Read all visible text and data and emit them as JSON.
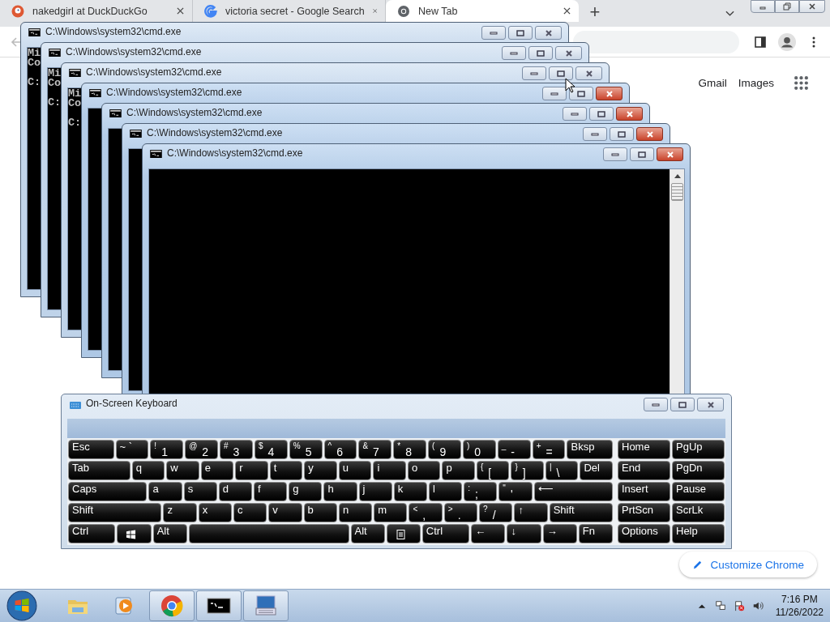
{
  "browser": {
    "tabs": [
      {
        "title": "nakedgirl at DuckDuckGo",
        "selected": false
      },
      {
        "title": "victoria secret - Google Search",
        "selected": false
      },
      {
        "title": "New Tab",
        "selected": true
      }
    ],
    "new_tab": "+",
    "links": [
      "Gmail",
      "Images"
    ],
    "customize": "Customize Chrome"
  },
  "cmd_windows": [
    {
      "title": "C:\\Windows\\system32\\cmd.exe",
      "active": false,
      "lines": [
        "Mi",
        "Co",
        "C:"
      ]
    },
    {
      "title": "C:\\Windows\\system32\\cmd.exe",
      "active": false,
      "lines": [
        "Mi",
        "Co",
        "C:"
      ]
    },
    {
      "title": "C:\\Windows\\system32\\cmd.exe",
      "active": false,
      "lines": [
        "Mi",
        "Co",
        "C:"
      ]
    },
    {
      "title": "C:\\Windows\\system32\\cmd.exe",
      "active": true
    },
    {
      "title": "C:\\Windows\\system32\\cmd.exe",
      "active": true
    },
    {
      "title": "C:\\Windows\\system32\\cmd.exe",
      "active": true
    },
    {
      "title": "C:\\Windows\\system32\\cmd.exe",
      "active": true
    }
  ],
  "keyboard": {
    "title": "On-Screen Keyboard",
    "rows": [
      {
        "keys": [
          {
            "label": "Esc",
            "kind": "wide"
          },
          {
            "label": "~ `",
            "kind": "normal"
          },
          {
            "shift": "!",
            "label": "1",
            "kind": "normal"
          },
          {
            "shift": "@",
            "label": "2",
            "kind": "normal"
          },
          {
            "shift": "#",
            "label": "3",
            "kind": "normal"
          },
          {
            "shift": "$",
            "label": "4",
            "kind": "normal"
          },
          {
            "shift": "%",
            "label": "5",
            "kind": "normal"
          },
          {
            "shift": "^",
            "label": "6",
            "kind": "normal"
          },
          {
            "shift": "&",
            "label": "7",
            "kind": "normal"
          },
          {
            "shift": "*",
            "label": "8",
            "kind": "normal"
          },
          {
            "shift": "(",
            "label": "9",
            "kind": "normal"
          },
          {
            "shift": ")",
            "label": "0",
            "kind": "normal"
          },
          {
            "shift": "_",
            "label": "-",
            "kind": "normal"
          },
          {
            "shift": "+",
            "label": "=",
            "kind": "normal"
          },
          {
            "label": "Bksp",
            "kind": "wide"
          }
        ]
      },
      {
        "keys": [
          {
            "label": "Tab",
            "kind": "wider"
          },
          {
            "label": "q",
            "kind": "normal"
          },
          {
            "label": "w",
            "kind": "normal"
          },
          {
            "label": "e",
            "kind": "normal"
          },
          {
            "label": "r",
            "kind": "normal"
          },
          {
            "label": "t",
            "kind": "normal"
          },
          {
            "label": "y",
            "kind": "normal"
          },
          {
            "label": "u",
            "kind": "normal"
          },
          {
            "label": "i",
            "kind": "normal"
          },
          {
            "label": "o",
            "kind": "normal"
          },
          {
            "label": "p",
            "kind": "normal"
          },
          {
            "shift": "{",
            "label": "[",
            "kind": "normal"
          },
          {
            "shift": "}",
            "label": "]",
            "kind": "normal"
          },
          {
            "shift": "|",
            "label": "\\",
            "kind": "normal"
          },
          {
            "label": "Del",
            "kind": "normal"
          }
        ]
      },
      {
        "keys": [
          {
            "label": "Caps",
            "kind": "broad"
          },
          {
            "label": "a",
            "kind": "normal"
          },
          {
            "label": "s",
            "kind": "normal"
          },
          {
            "label": "d",
            "kind": "normal"
          },
          {
            "label": "f",
            "kind": "normal"
          },
          {
            "label": "g",
            "kind": "normal"
          },
          {
            "label": "h",
            "kind": "normal"
          },
          {
            "label": "j",
            "kind": "normal"
          },
          {
            "label": "k",
            "kind": "normal"
          },
          {
            "label": "l",
            "kind": "normal"
          },
          {
            "shift": ":",
            "label": ";",
            "kind": "normal"
          },
          {
            "shift": "\"",
            "label": "'",
            "kind": "normal"
          },
          {
            "label": "⟵",
            "kind": "broad"
          }
        ]
      },
      {
        "keys": [
          {
            "label": "Shift",
            "kind": "shift"
          },
          {
            "label": "z",
            "kind": "normal"
          },
          {
            "label": "x",
            "kind": "normal"
          },
          {
            "label": "c",
            "kind": "normal"
          },
          {
            "label": "v",
            "kind": "normal"
          },
          {
            "label": "b",
            "kind": "normal"
          },
          {
            "label": "n",
            "kind": "normal"
          },
          {
            "label": "m",
            "kind": "normal"
          },
          {
            "shift": "<",
            "label": ",",
            "kind": "normal"
          },
          {
            "shift": ">",
            "label": ".",
            "kind": "normal"
          },
          {
            "shift": "?",
            "label": "/",
            "kind": "normal"
          },
          {
            "label": "↑",
            "kind": "normal"
          },
          {
            "label": "Shift",
            "kind": "wider"
          }
        ]
      },
      {
        "keys": [
          {
            "label": "Ctrl",
            "kind": "wide"
          },
          {
            "kind": "windows"
          },
          {
            "label": "Alt",
            "kind": "normal"
          },
          {
            "kind": "space"
          },
          {
            "label": "Alt",
            "kind": "normal"
          },
          {
            "kind": "menu"
          },
          {
            "label": "Ctrl",
            "kind": "wide"
          },
          {
            "label": "←",
            "kind": "normal"
          },
          {
            "label": "↓",
            "kind": "normal"
          },
          {
            "label": "→",
            "kind": "normal"
          },
          {
            "label": "Fn",
            "kind": "normal"
          }
        ]
      }
    ],
    "nav_rows": [
      {
        "keys": [
          "Home",
          "PgUp"
        ]
      },
      {
        "keys": [
          "End",
          "PgDn"
        ]
      },
      {
        "keys": [
          "Insert",
          "Pause"
        ]
      },
      {
        "keys": [
          "PrtScn",
          "ScrLk"
        ]
      },
      {
        "keys": [
          "Options",
          "Help"
        ]
      }
    ]
  },
  "taskbar": {
    "items": [
      {
        "selected": false
      },
      {
        "selected": false
      },
      {
        "selected": true
      },
      {
        "selected": true
      },
      {
        "selected": true
      }
    ],
    "time": "7:16 PM",
    "date": "11/26/2022"
  }
}
